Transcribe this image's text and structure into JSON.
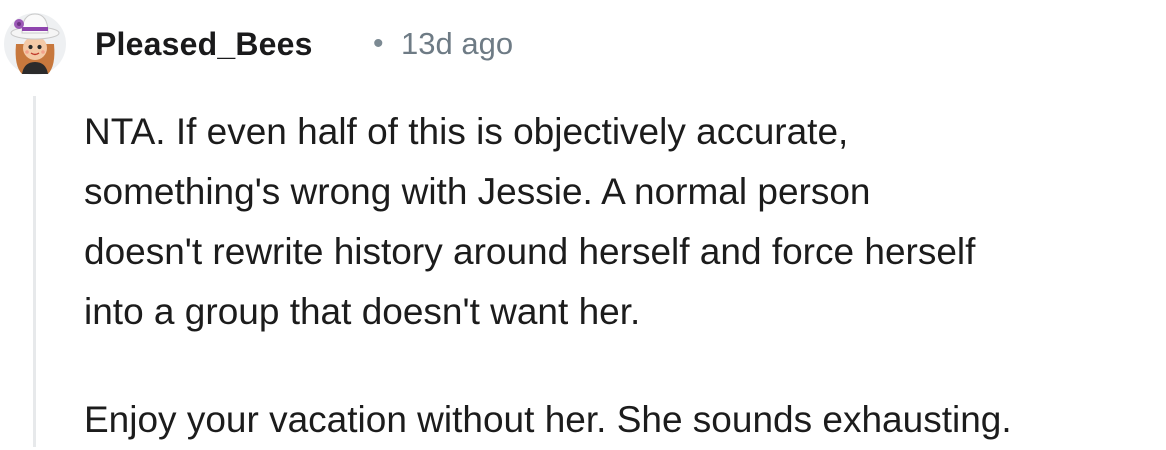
{
  "comment": {
    "author": "Pleased_Bees",
    "separator": "•",
    "timestamp": "13d ago",
    "avatar_icon": "snoo-avatar-with-hat-icon",
    "paragraphs": [
      {
        "lines": [
          "NTA. If even half of this is objectively accurate,",
          "something's wrong with Jessie. A normal person",
          "doesn't rewrite history around herself and force herself",
          "into a group that doesn't want her."
        ]
      },
      {
        "lines": [
          "Enjoy your vacation without her. She sounds exhausting."
        ]
      }
    ]
  },
  "colors": {
    "text": "#1c1c1c",
    "meta": "#6e7b85",
    "thread_line": "#e7e9eb",
    "background": "#ffffff"
  }
}
